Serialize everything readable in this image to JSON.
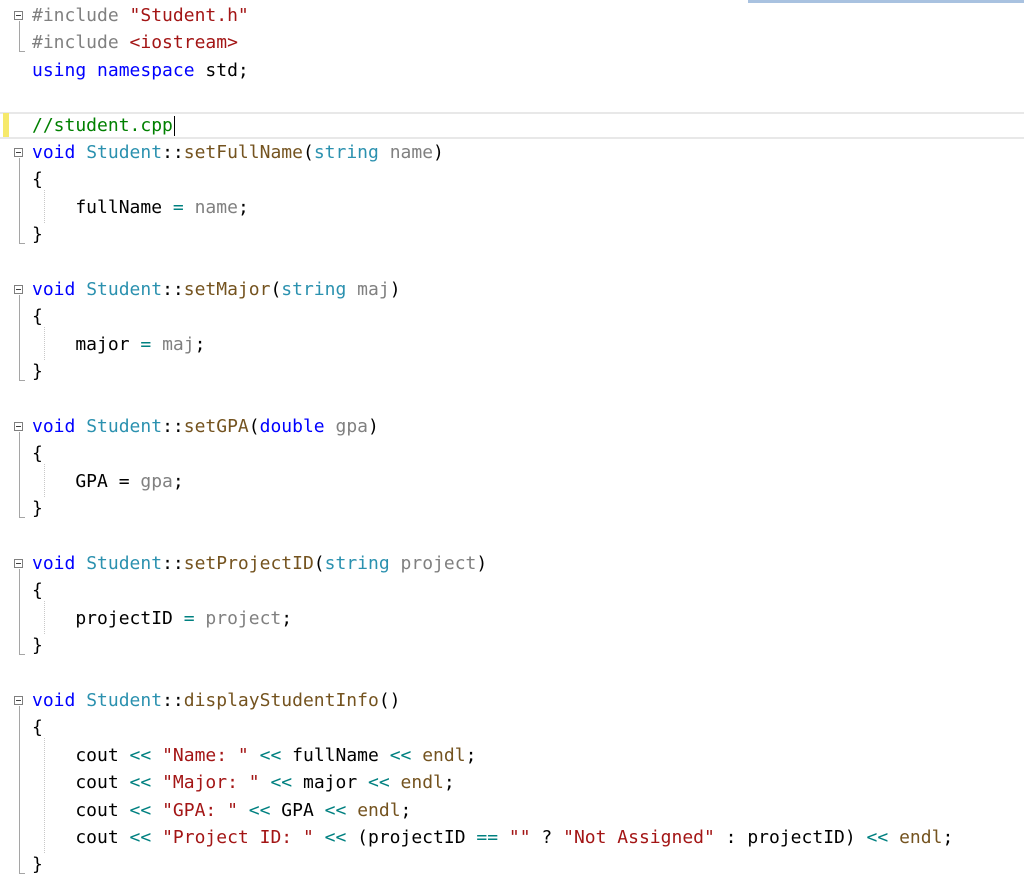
{
  "editor": {
    "lines": [
      [
        [
          "pp",
          "#include "
        ],
        [
          "st",
          "\"Student.h\""
        ]
      ],
      [
        [
          "pp",
          "#include "
        ],
        [
          "st",
          "<iostream>"
        ]
      ],
      [
        [
          "kw",
          "using"
        ],
        [
          "tx",
          " "
        ],
        [
          "kw",
          "namespace"
        ],
        [
          "tx",
          " std;"
        ]
      ],
      [],
      [
        [
          "cm",
          "//student.cpp"
        ]
      ],
      [
        [
          "kw",
          "void"
        ],
        [
          "tx",
          " "
        ],
        [
          "ty",
          "Student"
        ],
        [
          "tx",
          "::"
        ],
        [
          "fn",
          "setFullName"
        ],
        [
          "tx",
          "("
        ],
        [
          "ty",
          "string"
        ],
        [
          "tx",
          " "
        ],
        [
          "param",
          "name"
        ],
        [
          "tx",
          ")"
        ]
      ],
      [
        [
          "tx",
          "{"
        ]
      ],
      [
        [
          "tx",
          "    fullName "
        ],
        [
          "op",
          "="
        ],
        [
          "tx",
          " "
        ],
        [
          "param",
          "name"
        ],
        [
          "tx",
          ";"
        ]
      ],
      [
        [
          "tx",
          "}"
        ]
      ],
      [],
      [
        [
          "kw",
          "void"
        ],
        [
          "tx",
          " "
        ],
        [
          "ty",
          "Student"
        ],
        [
          "tx",
          "::"
        ],
        [
          "fn",
          "setMajor"
        ],
        [
          "tx",
          "("
        ],
        [
          "ty",
          "string"
        ],
        [
          "tx",
          " "
        ],
        [
          "param",
          "maj"
        ],
        [
          "tx",
          ")"
        ]
      ],
      [
        [
          "tx",
          "{"
        ]
      ],
      [
        [
          "tx",
          "    major "
        ],
        [
          "op",
          "="
        ],
        [
          "tx",
          " "
        ],
        [
          "param",
          "maj"
        ],
        [
          "tx",
          ";"
        ]
      ],
      [
        [
          "tx",
          "}"
        ]
      ],
      [],
      [
        [
          "kw",
          "void"
        ],
        [
          "tx",
          " "
        ],
        [
          "ty",
          "Student"
        ],
        [
          "tx",
          "::"
        ],
        [
          "fn",
          "setGPA"
        ],
        [
          "tx",
          "("
        ],
        [
          "kw",
          "double"
        ],
        [
          "tx",
          " "
        ],
        [
          "param",
          "gpa"
        ],
        [
          "tx",
          ")"
        ]
      ],
      [
        [
          "tx",
          "{"
        ]
      ],
      [
        [
          "tx",
          "    GPA = "
        ],
        [
          "param",
          "gpa"
        ],
        [
          "tx",
          ";"
        ]
      ],
      [
        [
          "tx",
          "}"
        ]
      ],
      [],
      [
        [
          "kw",
          "void"
        ],
        [
          "tx",
          " "
        ],
        [
          "ty",
          "Student"
        ],
        [
          "tx",
          "::"
        ],
        [
          "fn",
          "setProjectID"
        ],
        [
          "tx",
          "("
        ],
        [
          "ty",
          "string"
        ],
        [
          "tx",
          " "
        ],
        [
          "param",
          "project"
        ],
        [
          "tx",
          ")"
        ]
      ],
      [
        [
          "tx",
          "{"
        ]
      ],
      [
        [
          "tx",
          "    projectID "
        ],
        [
          "op",
          "="
        ],
        [
          "tx",
          " "
        ],
        [
          "param",
          "project"
        ],
        [
          "tx",
          ";"
        ]
      ],
      [
        [
          "tx",
          "}"
        ]
      ],
      [],
      [
        [
          "kw",
          "void"
        ],
        [
          "tx",
          " "
        ],
        [
          "ty",
          "Student"
        ],
        [
          "tx",
          "::"
        ],
        [
          "fn",
          "displayStudentInfo"
        ],
        [
          "tx",
          "()"
        ]
      ],
      [
        [
          "tx",
          "{"
        ]
      ],
      [
        [
          "tx",
          "    cout "
        ],
        [
          "op",
          "<<"
        ],
        [
          "tx",
          " "
        ],
        [
          "st",
          "\"Name: \""
        ],
        [
          "tx",
          " "
        ],
        [
          "op",
          "<<"
        ],
        [
          "tx",
          " fullName "
        ],
        [
          "op",
          "<<"
        ],
        [
          "tx",
          " "
        ],
        [
          "fn",
          "endl"
        ],
        [
          "tx",
          ";"
        ]
      ],
      [
        [
          "tx",
          "    cout "
        ],
        [
          "op",
          "<<"
        ],
        [
          "tx",
          " "
        ],
        [
          "st",
          "\"Major: \""
        ],
        [
          "tx",
          " "
        ],
        [
          "op",
          "<<"
        ],
        [
          "tx",
          " major "
        ],
        [
          "op",
          "<<"
        ],
        [
          "tx",
          " "
        ],
        [
          "fn",
          "endl"
        ],
        [
          "tx",
          ";"
        ]
      ],
      [
        [
          "tx",
          "    cout "
        ],
        [
          "op",
          "<<"
        ],
        [
          "tx",
          " "
        ],
        [
          "st",
          "\"GPA: \""
        ],
        [
          "tx",
          " "
        ],
        [
          "op",
          "<<"
        ],
        [
          "tx",
          " GPA "
        ],
        [
          "op",
          "<<"
        ],
        [
          "tx",
          " "
        ],
        [
          "fn",
          "endl"
        ],
        [
          "tx",
          ";"
        ]
      ],
      [
        [
          "tx",
          "    cout "
        ],
        [
          "op",
          "<<"
        ],
        [
          "tx",
          " "
        ],
        [
          "st",
          "\"Project ID: \""
        ],
        [
          "tx",
          " "
        ],
        [
          "op",
          "<<"
        ],
        [
          "tx",
          " (projectID "
        ],
        [
          "op",
          "=="
        ],
        [
          "tx",
          " "
        ],
        [
          "st",
          "\"\""
        ],
        [
          "tx",
          " ? "
        ],
        [
          "st",
          "\"Not Assigned\""
        ],
        [
          "tx",
          " : projectID) "
        ],
        [
          "op",
          "<<"
        ],
        [
          "tx",
          " "
        ],
        [
          "fn",
          "endl"
        ],
        [
          "tx",
          ";"
        ]
      ],
      [
        [
          "tx",
          "}"
        ]
      ]
    ],
    "current_line": 4,
    "changed_lines": [
      4
    ],
    "outline_blocks": [
      {
        "start": 0,
        "end": 1,
        "fold_icon": "collapse-minus-icon"
      },
      {
        "start": 5,
        "end": 8,
        "fold_icon": "collapse-minus-icon"
      },
      {
        "start": 10,
        "end": 13,
        "fold_icon": "collapse-minus-icon"
      },
      {
        "start": 15,
        "end": 18,
        "fold_icon": "collapse-minus-icon"
      },
      {
        "start": 20,
        "end": 23,
        "fold_icon": "collapse-minus-icon"
      },
      {
        "start": 25,
        "end": 31,
        "fold_icon": "collapse-minus-icon"
      }
    ],
    "colors": {
      "keyword": "#0000ff",
      "type": "#2b91af",
      "function": "#74531f",
      "string": "#a31515",
      "preprocessor": "#808080",
      "comment": "#008000",
      "change_marker": "#f6e96b"
    }
  }
}
